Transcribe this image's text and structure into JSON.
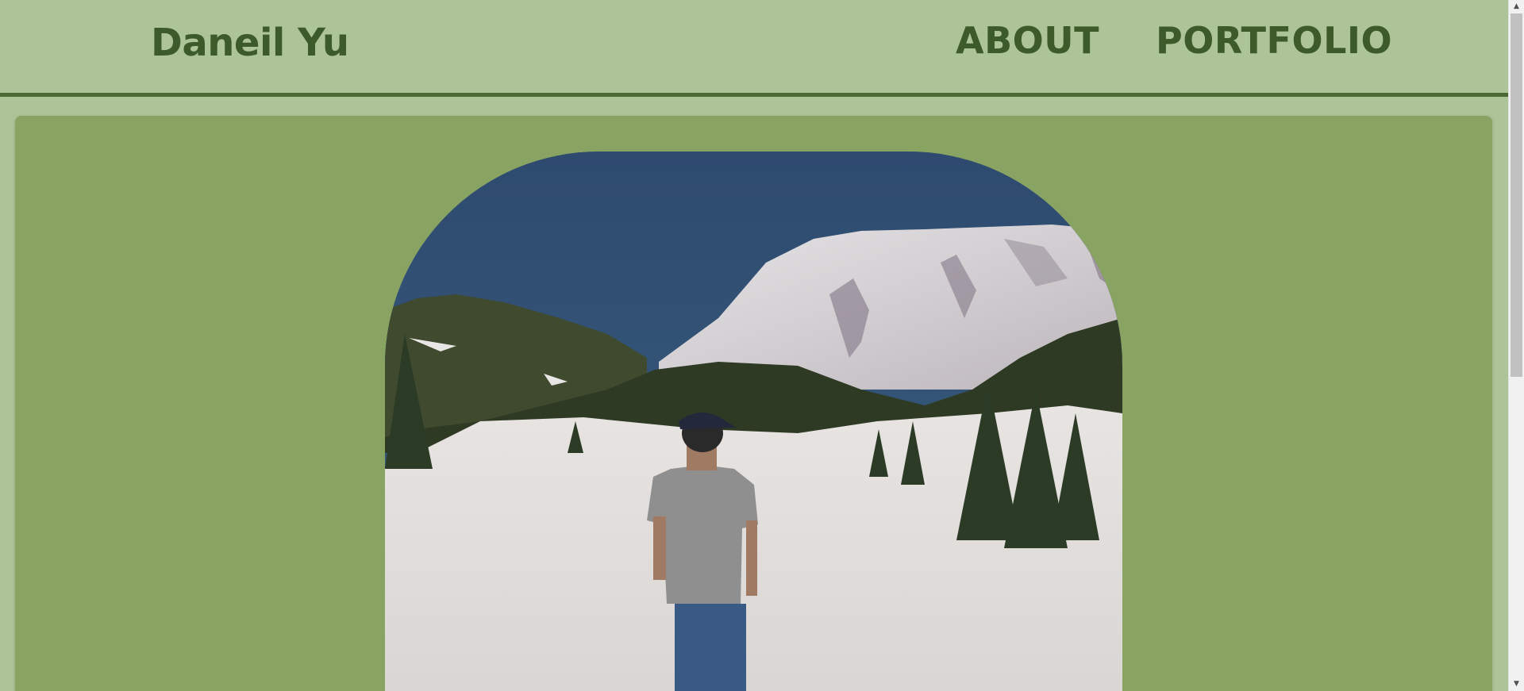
{
  "header": {
    "brand": "Daneil Yu",
    "nav": [
      {
        "label": "ABOUT"
      },
      {
        "label": "PORTFOLIO"
      }
    ]
  },
  "hero": {
    "image_alt": "Person standing in snow looking at a mountain"
  },
  "colors": {
    "background": "#adc398",
    "header_text": "#3d5a2a",
    "header_border": "#4a6a34",
    "card": "#88a362"
  },
  "scrollbar": {
    "position_fraction": 0.0
  }
}
